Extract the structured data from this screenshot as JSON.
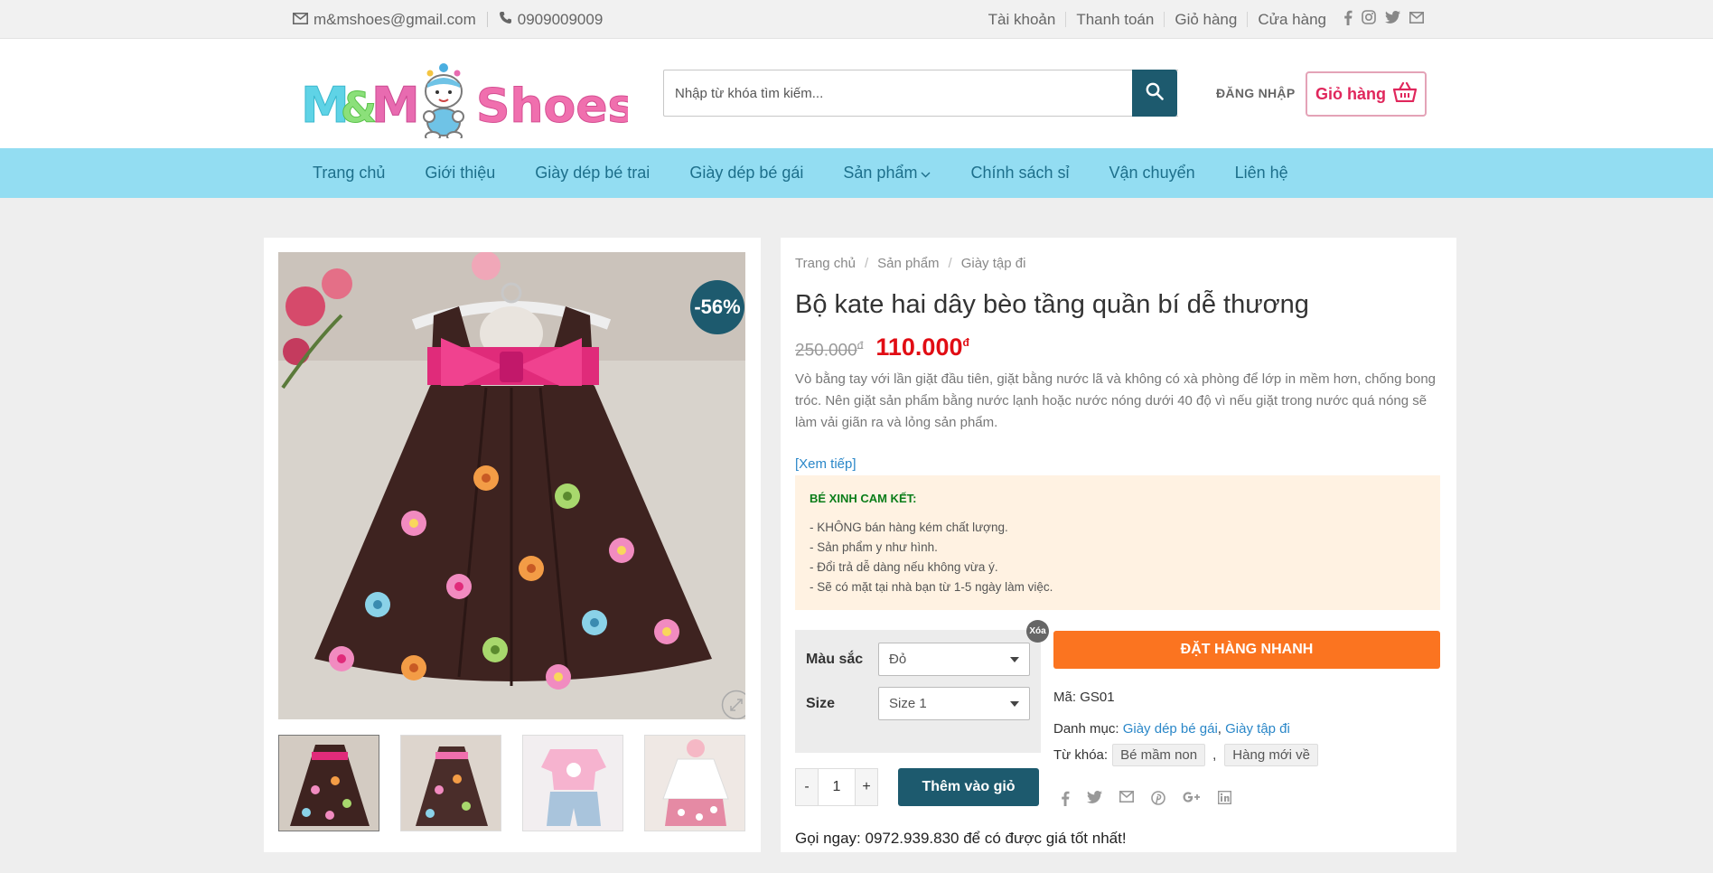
{
  "topbar": {
    "email": "m&mshoes@gmail.com",
    "phone": "0909009009",
    "links": [
      "Tài khoản",
      "Thanh toán",
      "Giỏ hàng",
      "Cửa hàng"
    ]
  },
  "header": {
    "search_placeholder": "Nhập từ khóa tìm kiếm...",
    "login_label": "ĐĂNG NHẬP",
    "cart_label": "Giỏ hàng"
  },
  "nav": {
    "items": [
      "Trang chủ",
      "Giới thiệu",
      "Giày dép bé trai",
      "Giày dép bé gái",
      "Sản phẩm",
      "Chính sách sỉ",
      "Vận chuyển",
      "Liên hệ"
    ]
  },
  "product": {
    "badge": "-56%",
    "breadcrumb": [
      "Trang chủ",
      "Sản phẩm",
      "Giày tập đi"
    ],
    "title": "Bộ kate hai dây bèo tầng quần bí dễ thương",
    "old_price": "250.000",
    "new_price": "110.000",
    "currency": "đ",
    "description": "Vò bằng tay với lần giặt đầu tiên, giặt bằng nước lã và không có xà phòng để lớp in mềm hơn, chống bong tróc. Nên giặt sản phẩm bằng nước lạnh hoặc nước nóng dưới 40 độ vì nếu giặt trong nước quá nóng sẽ làm vải giãn ra và lỏng sản phẩm.",
    "read_more": "[Xem tiếp]",
    "commit_title": "BÉ XINH CAM KẾT:",
    "commit_items": [
      "- KHÔNG bán hàng kém chất lượng.",
      "- Sản phẩm y như hình.",
      "- Đổi trả dễ dàng nếu không vừa ý.",
      "- Sẽ có mặt tại nhà bạn từ 1-5 ngày làm việc."
    ],
    "color_label": "Màu sắc",
    "color_value": "Đỏ",
    "size_label": "Size",
    "size_value": "Size 1",
    "clear_label": "Xóa",
    "quantity": "1",
    "minus": "-",
    "plus": "+",
    "add_to_cart": "Thêm vào giỏ",
    "buy_now": "ĐẶT HÀNG NHANH",
    "sku_label": "Mã:",
    "sku": "GS01",
    "category_label": "Danh mục:",
    "categories": [
      "Giày dép bé gái",
      "Giày tập đi"
    ],
    "tags_label": "Từ khóa:",
    "tags": [
      "Bé mầm non",
      "Hàng mới về"
    ],
    "call_text": "Gọi ngay: 0972.939.830 để có được giá tốt nhất!"
  },
  "colors": {
    "teal": "#1d5a6e",
    "nav_bg": "#93ddf2",
    "price_red": "#e10d14",
    "buy_orange": "#fb7420",
    "logo_pink": "#f06fae",
    "logo_cyan": "#5fd3e6"
  },
  "icons": [
    "envelope-icon",
    "phone-icon",
    "facebook-icon",
    "instagram-icon",
    "twitter-icon",
    "mail-icon",
    "search-icon",
    "basket-icon",
    "chevron-down-icon",
    "expand-icon",
    "pinterest-icon",
    "google-plus-icon",
    "linkedin-icon"
  ]
}
